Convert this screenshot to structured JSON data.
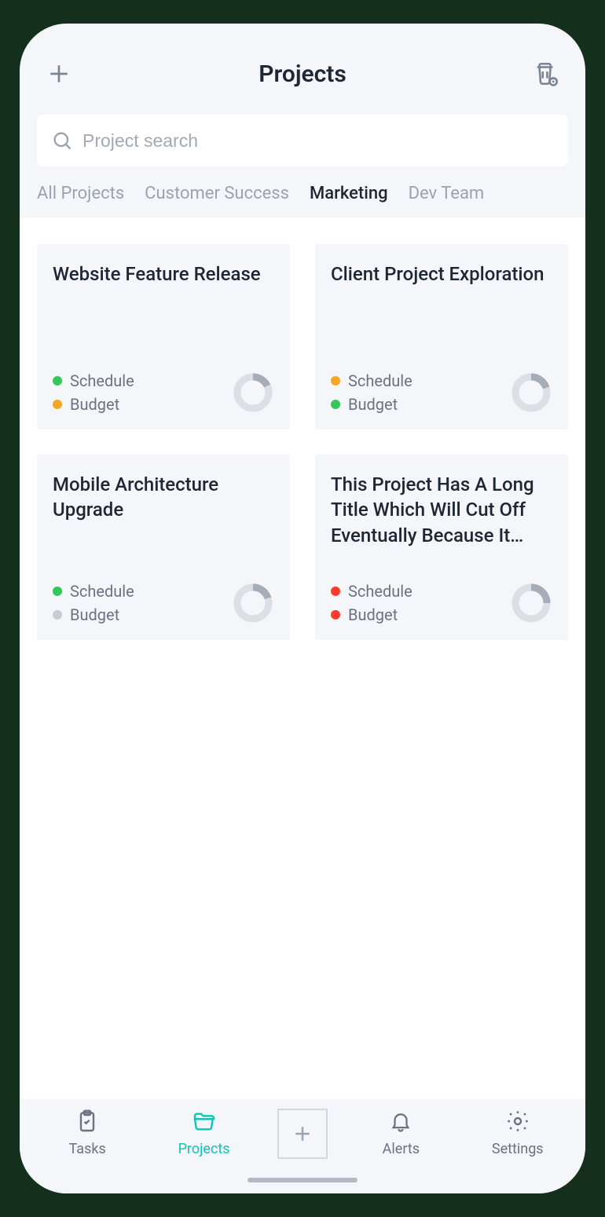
{
  "header": {
    "title": "Projects"
  },
  "search": {
    "placeholder": "Project search"
  },
  "tabs": [
    {
      "label": "All Projects",
      "active": false
    },
    {
      "label": "Customer Success",
      "active": false
    },
    {
      "label": "Marketing",
      "active": true
    },
    {
      "label": "Dev Team",
      "active": false
    }
  ],
  "status_labels": {
    "schedule": "Schedule",
    "budget": "Budget"
  },
  "colors": {
    "green": "#34c759",
    "orange": "#f5a623",
    "red": "#ff3b30",
    "gray": "#c6ccd4",
    "ring_bg": "#dcdfe3",
    "ring_fg": "#a6adb8",
    "accent": "#10c4b5"
  },
  "projects": [
    {
      "title": "Website Feature Release",
      "schedule": "green",
      "budget": "orange",
      "progress": 18
    },
    {
      "title": "Client Project Exploration",
      "schedule": "orange",
      "budget": "green",
      "progress": 20
    },
    {
      "title": "Mobile Architecture Upgrade",
      "schedule": "green",
      "budget": "gray",
      "progress": 20
    },
    {
      "title": "This Project Has A Long Title Which Will Cut Off Eventually Because It Keeps Going",
      "schedule": "red",
      "budget": "red",
      "progress": 25
    }
  ],
  "tabbar": [
    {
      "label": "Tasks",
      "icon": "clipboard",
      "active": false
    },
    {
      "label": "Projects",
      "icon": "folder",
      "active": true
    },
    {
      "label": "",
      "icon": "plus",
      "active": false
    },
    {
      "label": "Alerts",
      "icon": "bell",
      "active": false
    },
    {
      "label": "Settings",
      "icon": "gear",
      "active": false
    }
  ]
}
